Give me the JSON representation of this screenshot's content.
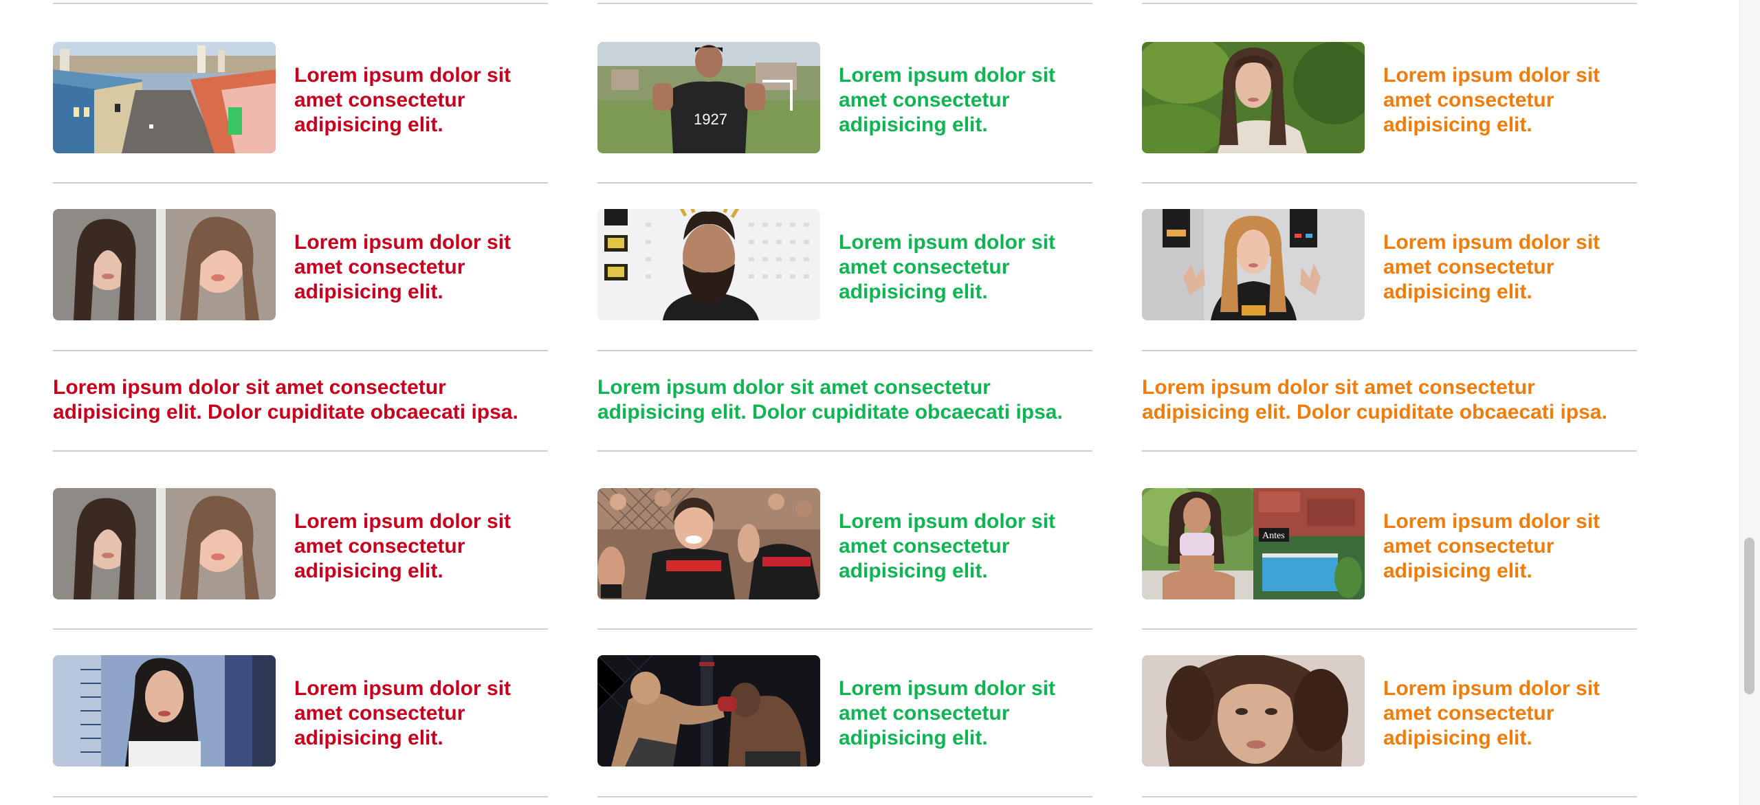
{
  "columns": [
    {
      "color": "#c8001e",
      "items": [
        {
          "title": "Lorem ipsum dolor sit amet consectetur adipisicing elit.",
          "image": "colorful-colonial-street-photo"
        },
        {
          "title": "Lorem ipsum dolor sit amet consectetur adipisicing elit.",
          "image": "two-women-selfie-photo"
        },
        {
          "title": "Lorem ipsum dolor sit amet consectetur adipisicing elit. Dolor cupiditate obcaecati ipsa."
        },
        {
          "title": "Lorem ipsum dolor sit amet consectetur adipisicing elit.",
          "image": "two-women-selfie-photo"
        },
        {
          "title": "Lorem ipsum dolor sit amet consectetur adipisicing elit.",
          "image": "woman-height-chart-photo"
        }
      ]
    },
    {
      "color": "#0fb552",
      "items": [
        {
          "title": "Lorem ipsum dolor sit amet consectetur adipisicing elit.",
          "image": "football-player-jersey-photo"
        },
        {
          "title": "Lorem ipsum dolor sit amet consectetur adipisicing elit.",
          "image": "bearded-fighter-portrait-photo"
        },
        {
          "title": "Lorem ipsum dolor sit amet consectetur adipisicing elit. Dolor cupiditate obcaecati ipsa."
        },
        {
          "title": "Lorem ipsum dolor sit amet consectetur adipisicing elit.",
          "image": "female-fighter-celebrating-photo"
        },
        {
          "title": "Lorem ipsum dolor sit amet consectetur adipisicing elit.",
          "image": "mma-fight-cage-photo"
        }
      ]
    },
    {
      "color": "#f07d0b",
      "items": [
        {
          "title": "Lorem ipsum dolor sit amet consectetur adipisicing elit.",
          "image": "woman-garden-portrait-photo"
        },
        {
          "title": "Lorem ipsum dolor sit amet consectetur adipisicing elit.",
          "image": "woman-video-gesture-photo"
        },
        {
          "title": "Lorem ipsum dolor sit amet consectetur adipisicing elit. Dolor cupiditate obcaecati ipsa."
        },
        {
          "title": "Lorem ipsum dolor sit amet consectetur adipisicing elit.",
          "image": "fitness-woman-and-pool-photo",
          "overlay_label": "Antes"
        },
        {
          "title": "Lorem ipsum dolor sit amet consectetur adipisicing elit.",
          "image": "woman-curly-hair-portrait-photo"
        }
      ]
    }
  ]
}
